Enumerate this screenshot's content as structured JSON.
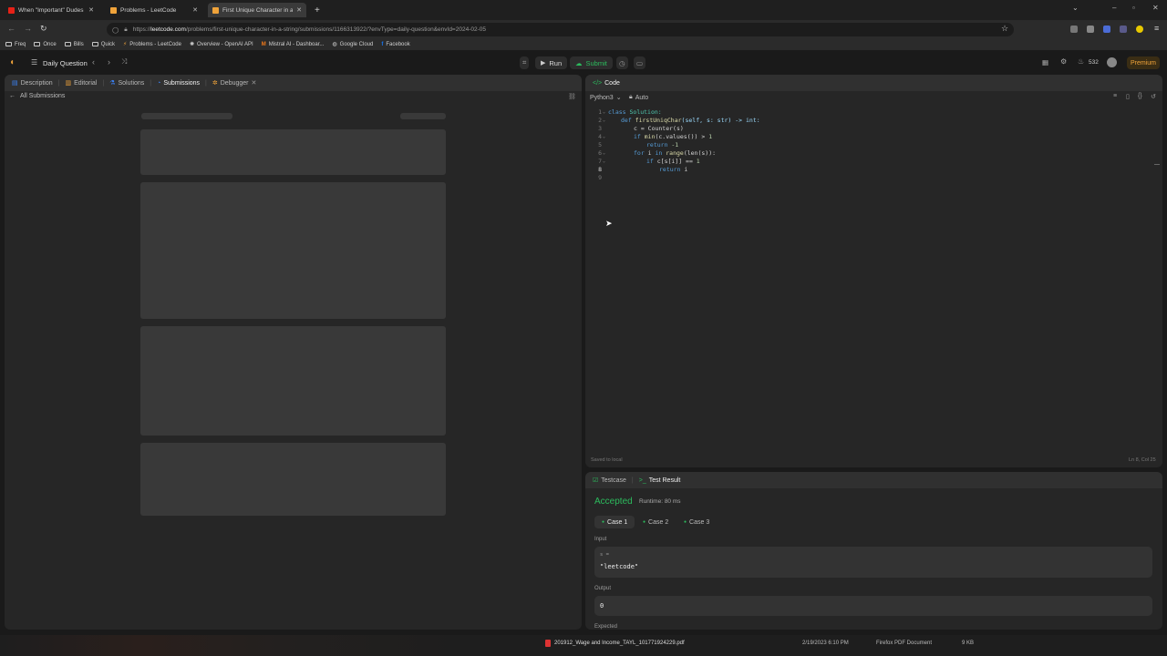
{
  "browser": {
    "tabs": [
      {
        "title": "When \"Important\" Dudes Men",
        "active": false
      },
      {
        "title": "Problems - LeetCode",
        "active": false
      },
      {
        "title": "First Unique Character in a Strin",
        "active": true
      }
    ],
    "url_prefix": "https://",
    "url_domain": "leetcode.com",
    "url_path": "/problems/first-unique-character-in-a-string/submissions/1166313922/?envType=daily-question&envId=2024-02-05",
    "bookmarks": [
      "Freq",
      "Once",
      "Bills",
      "Quick",
      "Problems - LeetCode",
      "Overview - OpenAI API",
      "Mistral AI - Dashboar...",
      "Google Cloud",
      "Facebook"
    ]
  },
  "lcnav": {
    "daily_question": "Daily Question",
    "run": "Run",
    "submit": "Submit",
    "streak": "532",
    "premium": "Premium"
  },
  "left_panel": {
    "tabs": [
      "Description",
      "Editorial",
      "Solutions",
      "Submissions",
      "Debugger"
    ],
    "back_link": "All Submissions"
  },
  "code_panel": {
    "title": "Code",
    "language": "Python3",
    "auto": "Auto",
    "lines": [
      {
        "n": "1"
      },
      {
        "n": "2"
      },
      {
        "n": "3"
      },
      {
        "n": "4"
      },
      {
        "n": "5"
      },
      {
        "n": "6"
      },
      {
        "n": "7"
      },
      {
        "n": "8"
      },
      {
        "n": "9"
      }
    ],
    "code": {
      "l1a": "class",
      "l1b": " Solution:",
      "l2a": "def",
      "l2b": " firstUniqChar",
      "l2c": "(self, s: str) -> int:",
      "l3": "c = Counter(s)",
      "l4a": "if",
      "l4b": " min",
      "l4c": "(c.values()) > ",
      "l4d": "1",
      "l5a": "return",
      "l5b": " -1",
      "l6a": "for",
      "l6b": " i ",
      "l6c": "in",
      "l6d": " range",
      "l6e": "(len(s)):",
      "l7a": "if",
      "l7b": " c[s[i]] == ",
      "l7c": "1",
      "l8a": "return",
      "l8b": " i"
    },
    "saved": "Saved to local",
    "cursor_pos": "Ln 8, Col 25"
  },
  "result_panel": {
    "tabs": [
      "Testcase",
      "Test Result"
    ],
    "status": "Accepted",
    "runtime": "Runtime: 80 ms",
    "cases": [
      "Case 1",
      "Case 2",
      "Case 3"
    ],
    "input_label": "Input",
    "input_var": "s =",
    "input_value": "\"leetcode\"",
    "output_label": "Output",
    "output_value": "0",
    "expected_label": "Expected"
  },
  "taskbar": {
    "file_name": "201912_Wage and Income_TAYL_101771924229.pdf",
    "file_date": "2/19/2023 6:10 PM",
    "file_type": "Firefox PDF Document",
    "file_size": "9 KB"
  },
  "colors": {
    "accent_green": "#2cbb5d",
    "premium": "#f0a33a",
    "panel": "#262626"
  }
}
